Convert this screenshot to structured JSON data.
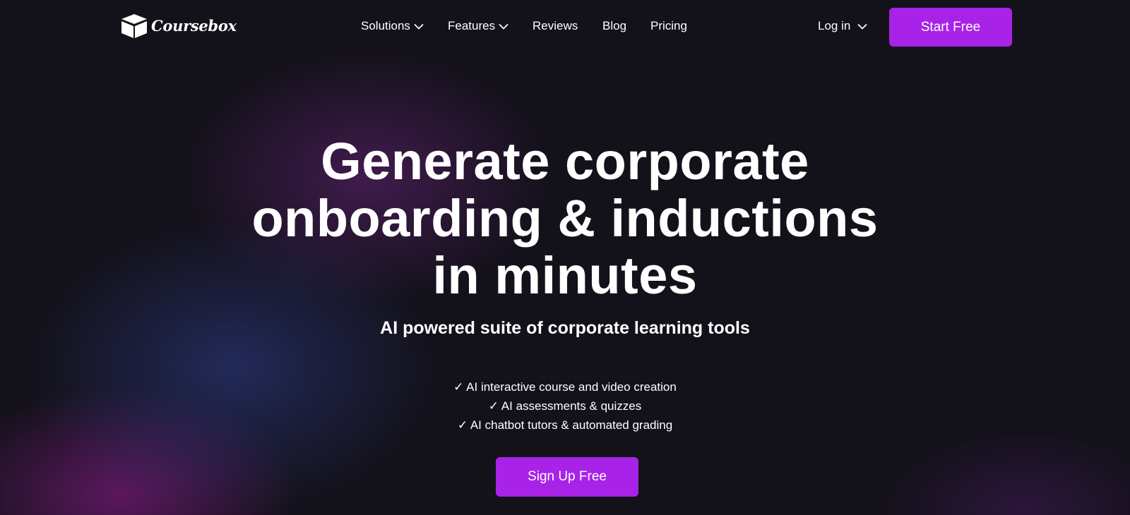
{
  "brand": {
    "name": "Coursebox",
    "logo_icon": "box-logo-icon"
  },
  "nav": {
    "items": [
      {
        "label": "Solutions",
        "dropdown": true
      },
      {
        "label": "Features",
        "dropdown": true
      },
      {
        "label": "Reviews",
        "dropdown": false
      },
      {
        "label": "Blog",
        "dropdown": false
      },
      {
        "label": "Pricing",
        "dropdown": false
      }
    ],
    "login_label": "Log in",
    "cta_label": "Start Free"
  },
  "hero": {
    "title_lines": [
      "Generate corporate",
      "onboarding & inductions",
      "in minutes"
    ],
    "subtitle": "AI powered suite of corporate learning tools",
    "features": [
      "✓ AI interactive course and video creation",
      "✓ AI assessments & quizzes",
      "✓ AI chatbot tutors & automated grading"
    ],
    "cta_label": "Sign Up Free"
  },
  "colors": {
    "accent": "#a922e8",
    "background": "#13111a",
    "text": "#ffffff"
  }
}
